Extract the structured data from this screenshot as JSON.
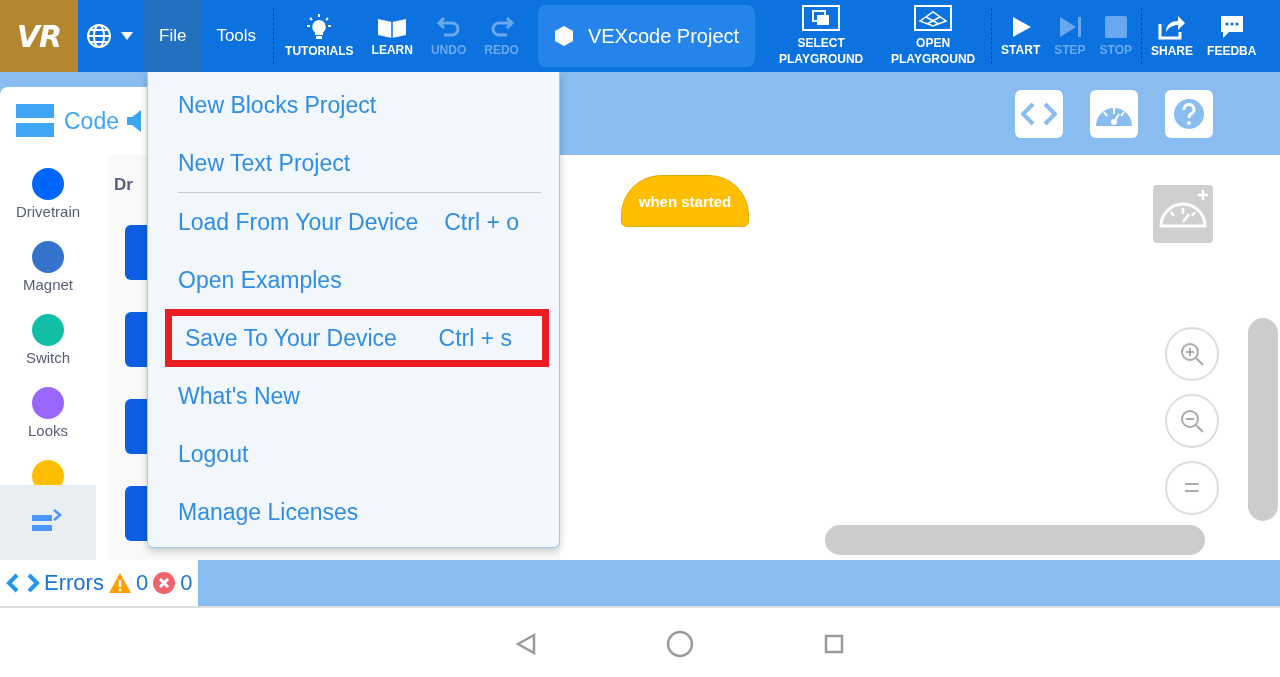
{
  "top_bar": {
    "logo": "VR",
    "menus": [
      {
        "label": "File",
        "selected": true
      },
      {
        "label": "Tools",
        "selected": false
      }
    ],
    "tools": [
      {
        "label": "TUTORIALS",
        "disabled": false
      },
      {
        "label": "LEARN",
        "disabled": false
      },
      {
        "label": "UNDO",
        "disabled": true
      },
      {
        "label": "REDO",
        "disabled": true
      }
    ],
    "project_name": "VEXcode Project",
    "playground_buttons": [
      {
        "label": "SELECT PLAYGROUND"
      },
      {
        "label": "OPEN PLAYGROUND"
      }
    ],
    "run_controls": [
      {
        "label": "START",
        "disabled": false
      },
      {
        "label": "STEP",
        "disabled": true
      },
      {
        "label": "STOP",
        "disabled": true
      }
    ],
    "right_buttons": [
      {
        "label": "SHARE"
      },
      {
        "label": "FEEDBA"
      }
    ]
  },
  "code_tab": {
    "label": "Code"
  },
  "categories": [
    {
      "label": "Drivetrain",
      "color": "#0066ff"
    },
    {
      "label": "Magnet",
      "color": "#3373cc"
    },
    {
      "label": "Switch",
      "color": "#10bfa5"
    },
    {
      "label": "Looks",
      "color": "#9966ff"
    },
    {
      "color": "#ffbf00"
    }
  ],
  "flyout": {
    "heading": "Dr"
  },
  "file_menu": [
    {
      "label": "New Blocks Project",
      "separator_after": false,
      "highlighted": false
    },
    {
      "label": "New Text Project",
      "separator_after": true,
      "highlighted": false
    },
    {
      "label": "Load From Your Device",
      "shortcut": "Ctrl + o",
      "separator_after": false,
      "highlighted": false
    },
    {
      "label": "Open Examples",
      "separator_after": false,
      "highlighted": false
    },
    {
      "label": "Save To Your Device",
      "shortcut": "Ctrl + s",
      "separator_after": false,
      "highlighted": true
    },
    {
      "label": "What's New",
      "separator_after": false,
      "highlighted": false
    },
    {
      "label": "Logout",
      "separator_after": false,
      "highlighted": false
    },
    {
      "label": "Manage Licenses",
      "separator_after": false,
      "highlighted": false
    }
  ],
  "workspace": {
    "event_block": "when started",
    "zoom_reset": "="
  },
  "errors_bar": {
    "label": "Errors",
    "warnings": "0",
    "errors": "0"
  }
}
